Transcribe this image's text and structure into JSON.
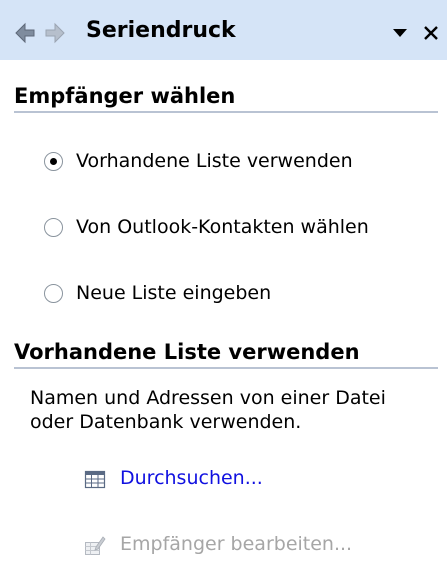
{
  "task_pane": {
    "title": "Seriendruck",
    "icons": [
      "back-arrow-icon",
      "forward-arrow-icon",
      "dropdown-triangle-icon",
      "close-icon"
    ]
  },
  "recipients_section": {
    "heading": "Empfänger wählen",
    "options": [
      {
        "label": "Vorhandene Liste verwenden",
        "checked": true
      },
      {
        "label": "Von Outlook-Kontakten wählen",
        "checked": false
      },
      {
        "label": "Neue Liste eingeben",
        "checked": false
      }
    ]
  },
  "existing_list_section": {
    "heading": "Vorhandene Liste verwenden",
    "description": "Namen und Adressen von einer Datei oder Datenbank verwenden.",
    "browse_label": "Durchsuchen...",
    "edit_label": "Empfänger bearbeiten..."
  },
  "colors": {
    "header_bg": "#d5e4f7",
    "link": "#1010e0",
    "disabled_text": "#a6a6a6",
    "heading_rule": "#b9c3d3"
  }
}
